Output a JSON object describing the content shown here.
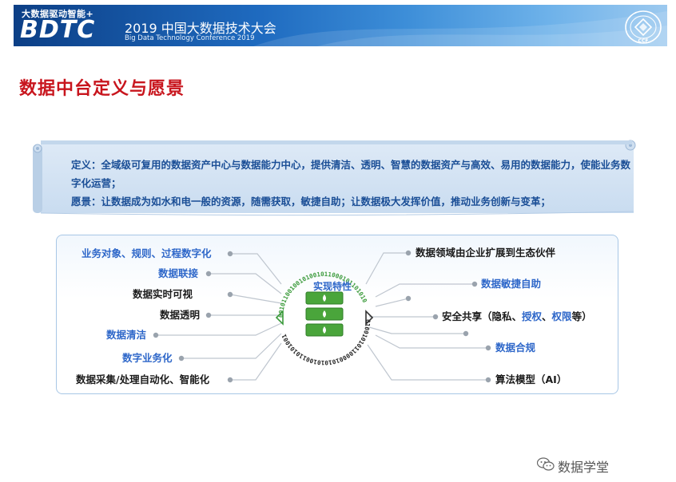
{
  "banner": {
    "tagline": "大数据驱动智能+",
    "logo": "BDTC",
    "title": "2019 中国大数据技术大会",
    "subtitle": "Big Data Technology Conference 2019",
    "seal": "中国计算机学会 CCF"
  },
  "page_title": "数据中台定义与愿景",
  "scroll": {
    "definition": "定义：全域级可复用的数据资产中心与数据能力中心，提供清洁、透明、智慧的数据资产与高效、易用的数据能力，使能业务数字化运营；",
    "vision": "愿景：让数据成为如水和电一般的资源，随需获取，敏捷自助；让数据极大发挥价值，推动业务创新与变革；"
  },
  "diagram": {
    "center_title": "实现特性",
    "binary_top": "00101100100101001011000101101010",
    "binary_bottom": "01001010110000101010100110101001",
    "left": [
      {
        "label": "业务对象、规则、过程数字化",
        "color": "blue"
      },
      {
        "label": "数据联接",
        "color": "blue"
      },
      {
        "label": "数据实时可视",
        "color": "dark"
      },
      {
        "label": "数据透明",
        "color": "dark"
      },
      {
        "label": "数据清洁",
        "color": "blue"
      },
      {
        "label": "数字业务化",
        "color": "blue"
      },
      {
        "label": "数据采集/处理自动化、智能化",
        "color": "dark"
      }
    ],
    "right": [
      {
        "label": "数据领域由企业扩展到生态伙伴",
        "color": "dark"
      },
      {
        "label": "数据敏捷自助",
        "color": "blue"
      },
      {
        "label": "",
        "color": "dark"
      },
      {
        "label_prefix": "安全共享（隐私、",
        "label_hl1": "授权",
        "label_mid": "、",
        "label_hl2": "权限",
        "label_suffix": "等）",
        "color": "dark"
      },
      {
        "label": "",
        "color": "dark"
      },
      {
        "label": "数据合规",
        "color": "blue"
      },
      {
        "label": "算法模型（AI）",
        "color": "dark"
      }
    ]
  },
  "watermark": "数据学堂",
  "colors": {
    "title_red": "#c8151d",
    "accent_blue": "#2e67c9",
    "server_green": "#4aa53b"
  }
}
